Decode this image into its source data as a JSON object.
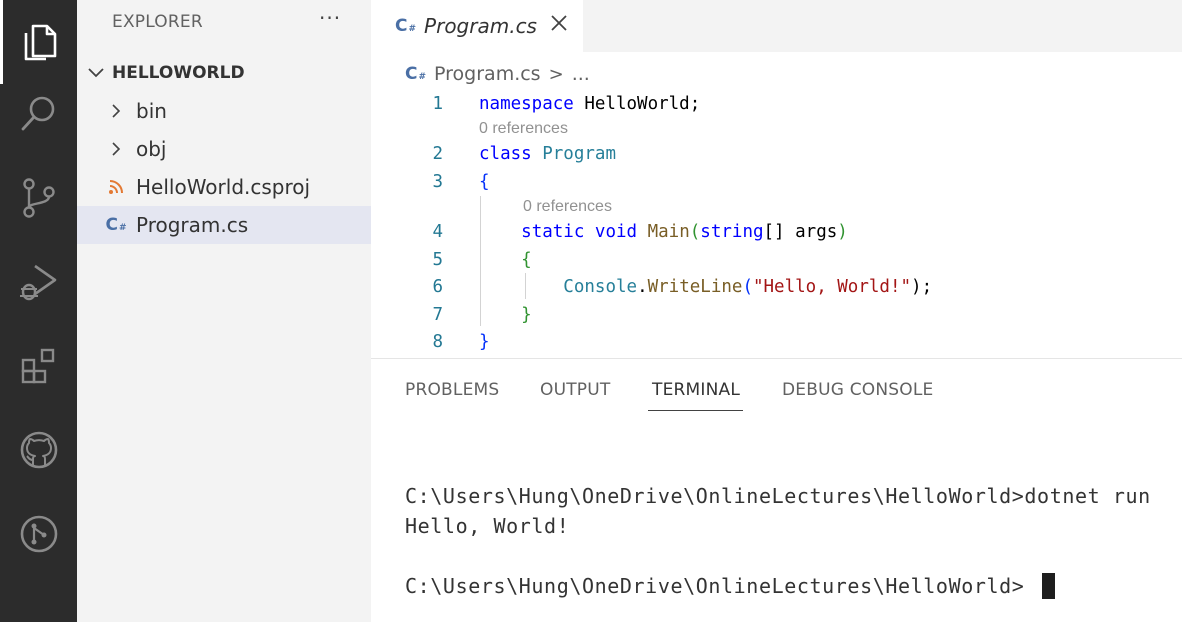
{
  "activity_bar": {
    "items": [
      {
        "name": "explorer",
        "icon": "files-icon",
        "active": true
      },
      {
        "name": "search",
        "icon": "search-icon"
      },
      {
        "name": "source-control",
        "icon": "source-control-icon"
      },
      {
        "name": "run-debug",
        "icon": "run-debug-icon"
      },
      {
        "name": "extensions",
        "icon": "extensions-icon"
      },
      {
        "name": "github",
        "icon": "github-icon"
      },
      {
        "name": "remote",
        "icon": "remote-icon"
      }
    ]
  },
  "sidebar": {
    "title": "EXPLORER",
    "more": "···",
    "folder": "HELLOWORLD",
    "items": [
      {
        "label": "bin",
        "icon": "chevron-right-icon"
      },
      {
        "label": "obj",
        "icon": "chevron-right-icon"
      },
      {
        "label": "HelloWorld.csproj",
        "icon": "rss-icon"
      },
      {
        "label": "Program.cs",
        "icon": "csharp-icon",
        "selected": true
      }
    ]
  },
  "editor": {
    "tab_label": "Program.cs",
    "breadcrumb": {
      "file": "Program.cs",
      "sep": ">",
      "more": "..."
    },
    "code_lens": "0 references",
    "line_numbers": [
      "1",
      "2",
      "3",
      "4",
      "5",
      "6",
      "7",
      "8"
    ],
    "lines": {
      "l1": {
        "kw": "namespace",
        "rest": " HelloWorld;"
      },
      "l2": {
        "kw": "class",
        "ty": " Program"
      },
      "l3": {
        "br": "{"
      },
      "l4": {
        "kw1": "static",
        "kw2": " void",
        "fn": " Main",
        "p1": "(",
        "kw3": "string",
        "p2": "[]",
        "arg": " args",
        "p3": ")"
      },
      "l5": {
        "br": "{"
      },
      "l6": {
        "ty": "Console",
        "dot": ".",
        "fn": "WriteLine",
        "p1": "(",
        "str": "\"Hello, World!\"",
        "p2": ");"
      },
      "l7": {
        "br": "}"
      },
      "l8": {
        "br": "}"
      }
    }
  },
  "panel": {
    "tabs": [
      "PROBLEMS",
      "OUTPUT",
      "TERMINAL",
      "DEBUG CONSOLE"
    ],
    "active_tab": "TERMINAL",
    "terminal_lines": [
      "C:\\Users\\Hung\\OneDrive\\OnlineLectures\\HelloWorld>dotnet run",
      "Hello, World!",
      "C:\\Users\\Hung\\OneDrive\\OnlineLectures\\HelloWorld>"
    ]
  },
  "colors": {
    "activity_bar": "#2c2c2c",
    "sidebar": "#f3f3f3",
    "selection": "#e4e6f1",
    "line_number": "#237893",
    "keyword": "#0000ff",
    "type": "#267f99",
    "function": "#795e26",
    "string": "#a31515"
  }
}
